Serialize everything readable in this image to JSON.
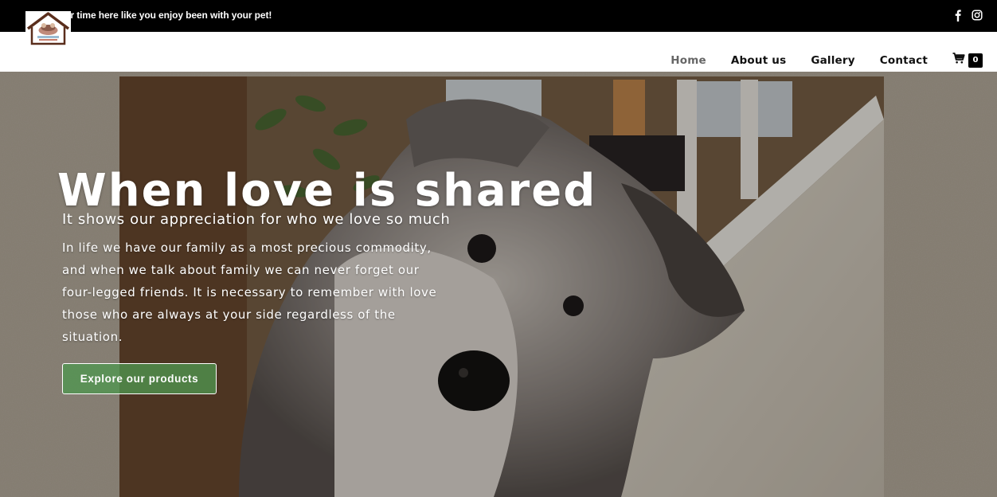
{
  "topbar": {
    "tagline": "Enjoy your time here like you enjoy been with your pet!",
    "social": [
      {
        "icon": "facebook-icon"
      },
      {
        "icon": "instagram-icon"
      }
    ]
  },
  "header": {
    "logo_icon": "pet-house-logo",
    "nav": [
      {
        "label": "Home",
        "active": true
      },
      {
        "label": "About us",
        "active": false
      },
      {
        "label": "Gallery",
        "active": false
      },
      {
        "label": "Contact",
        "active": false
      }
    ],
    "cart": {
      "icon": "cart-icon",
      "count": "0"
    }
  },
  "hero": {
    "title": "When love is shared",
    "subtitle": "It shows our appreciation for who we love so much",
    "body": "In life we have our family as a most precious commodity, and when we talk about family we can never forget our four-legged friends. It is necessary to remember with love those who are always at your side regardless of the situation.",
    "cta_label": "Explore our products",
    "cta_color": "#4f944f"
  },
  "colors": {
    "topbar_bg": "#000000",
    "nav_active": "#666666",
    "nav_text": "#111111"
  }
}
